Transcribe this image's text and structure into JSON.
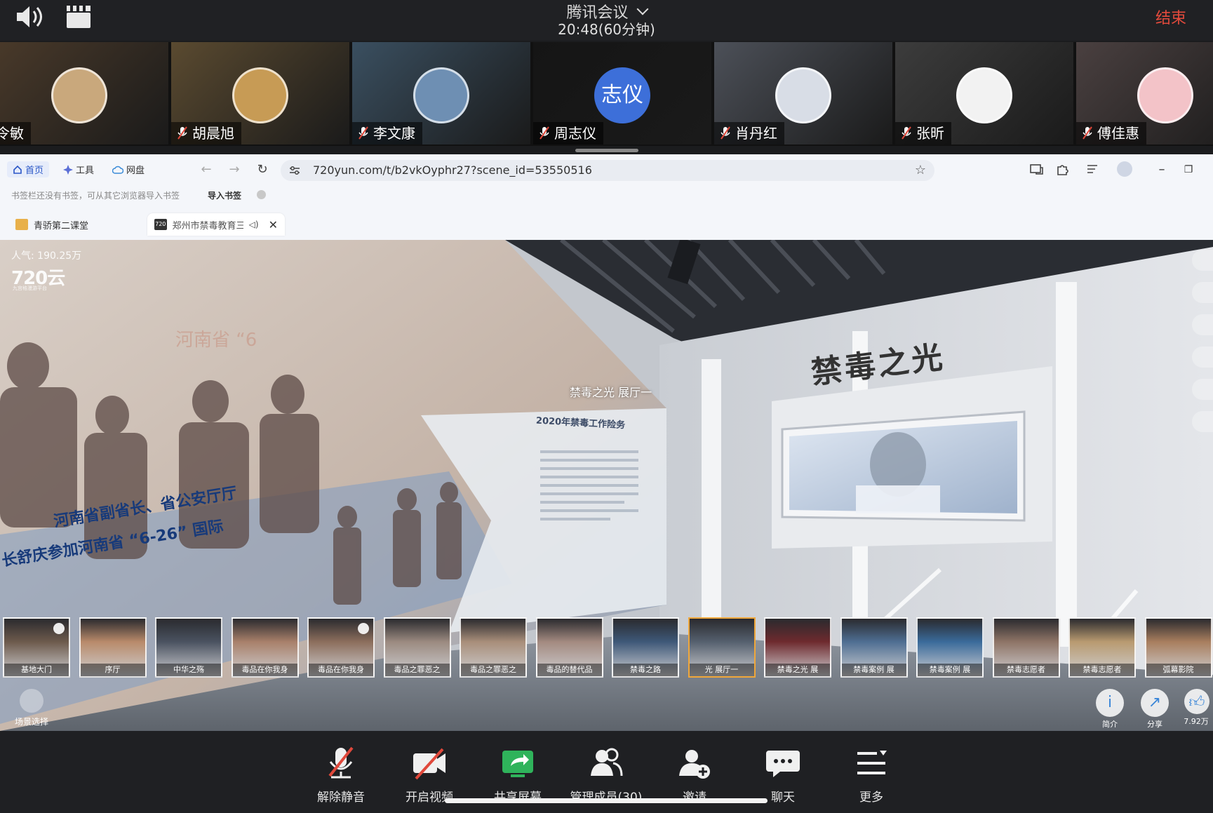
{
  "meeting": {
    "title": "腾讯会议",
    "timer": "20:48(60分钟)",
    "end_label": "结束"
  },
  "participants": [
    {
      "name": "令敏",
      "avatar_color": "#c9a87c",
      "tile_color": "#4a3a2a"
    },
    {
      "name": "胡晨旭",
      "avatar_color": "#c79b55",
      "tile_color": "#5a4a30"
    },
    {
      "name": "李文康",
      "avatar_color": "#6e8fb3",
      "tile_color": "#3a4f60"
    },
    {
      "name": "周志仪",
      "avatar_text": "志仪",
      "avatar_color": "#3d6fd9",
      "tile_color": "#151515"
    },
    {
      "name": "肖丹红",
      "avatar_color": "#d8dde6",
      "tile_color": "#4c5058"
    },
    {
      "name": "张昕",
      "avatar_color": "#f2f2f2",
      "tile_color": "#3c3c3c"
    },
    {
      "name": "傅佳惠",
      "avatar_color": "#f3c3c8",
      "tile_color": "#4a4040"
    }
  ],
  "browser": {
    "home_label": "首页",
    "tools_label": "工具",
    "cloud_label": "网盘",
    "url": "720yun.com/t/b2vkOyphr27?scene_id=53550516",
    "bookmark_message": "书签栏还没有书签，可从其它浏览器导入书签",
    "import_label": "导入书签",
    "tabs": [
      {
        "label": "青骄第二课堂",
        "favicon_color": "#e8b04a"
      },
      {
        "label": "郑州市禁毒教育三",
        "favicon_color": "#333333",
        "favicon_text": "720"
      }
    ]
  },
  "viewer": {
    "popularity": "人气: 190.25万",
    "brand": "720云",
    "brand_sub": "九宫格漫游平台",
    "hotspot": "禁毒之光 展厅一",
    "wall_title": "禁毒之光",
    "board_title": "2020年禁毒工作险务",
    "banner_lines": [
      "河南省副省长、省公安厅厅",
      "长舒庆参加河南省 “6-26” 国际"
    ],
    "thumbnails": [
      {
        "label": "基地大门",
        "checked": true
      },
      {
        "label": "序厅"
      },
      {
        "label": "中华之殇"
      },
      {
        "label": "毒品在你我身"
      },
      {
        "label": "毒品在你我身",
        "checked": true
      },
      {
        "label": "毒品之罪恶之"
      },
      {
        "label": "毒品之罪恶之"
      },
      {
        "label": "毒品的替代品"
      },
      {
        "label": "禁毒之路"
      },
      {
        "label": "光 展厅一",
        "selected": true
      },
      {
        "label": "禁毒之光 展"
      },
      {
        "label": "禁毒案例 展"
      },
      {
        "label": "禁毒案例 展"
      },
      {
        "label": "禁毒志愿者"
      },
      {
        "label": "禁毒志愿者"
      },
      {
        "label": "弧幕影院"
      }
    ],
    "scene_select_label": "场景选择",
    "intro_label": "简介",
    "share_label": "分享",
    "likes": "7.92万"
  },
  "toolbar": {
    "unmute": "解除静音",
    "video": "开启视频",
    "share": "共享屏幕",
    "members": "管理成员(30)",
    "invite": "邀请",
    "chat": "聊天",
    "more": "更多"
  }
}
